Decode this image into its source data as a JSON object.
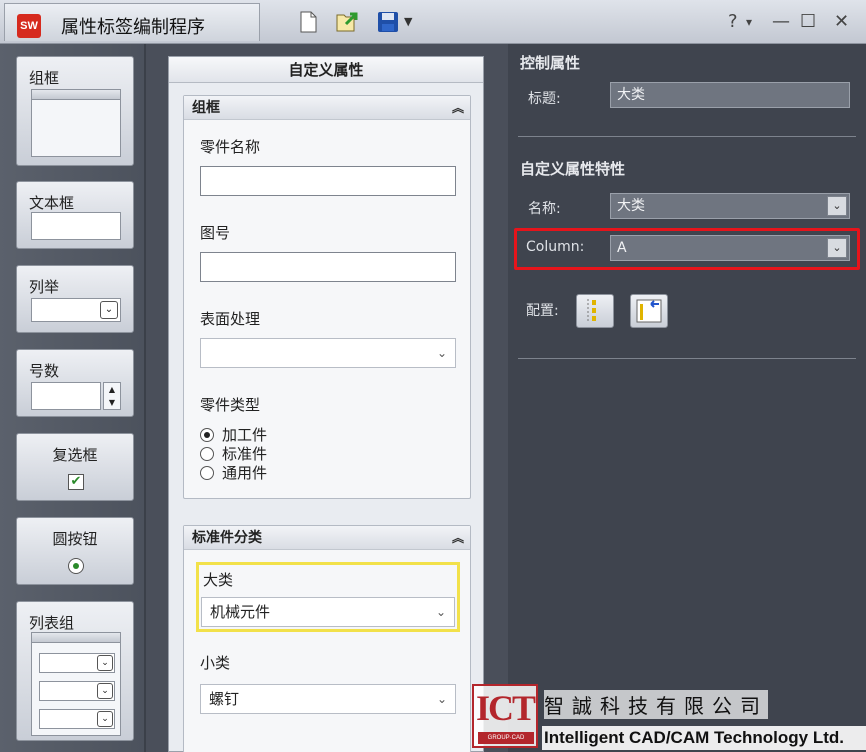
{
  "app": {
    "title": "属性标签编制程序",
    "logo_text": "SW"
  },
  "window_controls": {
    "help": "?",
    "help_menu": "▾",
    "minimize": "—",
    "maximize": "☐",
    "close": "✕"
  },
  "toolbox": {
    "group_box": "组框",
    "text_box": "文本框",
    "list": "列举",
    "number": "号数",
    "checkbox": "复选框",
    "radio": "圆按钮",
    "list_group": "列表组"
  },
  "form": {
    "title": "自定义属性",
    "group1": {
      "title": "组框",
      "part_name_label": "零件名称",
      "drawing_no_label": "图号",
      "surface_label": "表面处理",
      "surface_value": "",
      "part_type_label": "零件类型",
      "options": [
        "加工件",
        "标准件",
        "通用件"
      ],
      "selected_option": "加工件"
    },
    "group2": {
      "title": "标准件分类",
      "major_label": "大类",
      "major_value": "机械元件",
      "minor_label": "小类",
      "minor_value": "螺钉"
    }
  },
  "properties": {
    "control_heading": "控制属性",
    "caption_label": "标题:",
    "caption_value": "大类",
    "custom_heading": "自定义属性特性",
    "name_label": "名称:",
    "name_value": "大类",
    "column_label": "Column:",
    "column_value": "A",
    "config_label": "配置:"
  },
  "watermark": {
    "logo": "ICT",
    "logo_sub": "GROUP·CAD",
    "company_cn": "智誠科技有限公司",
    "company_en": "Intelligent CAD/CAM Technology Ltd."
  },
  "colors": {
    "highlight_red": "#e6141b",
    "highlight_yellow": "#f2e14a",
    "panel_dark": "#3f444e"
  }
}
